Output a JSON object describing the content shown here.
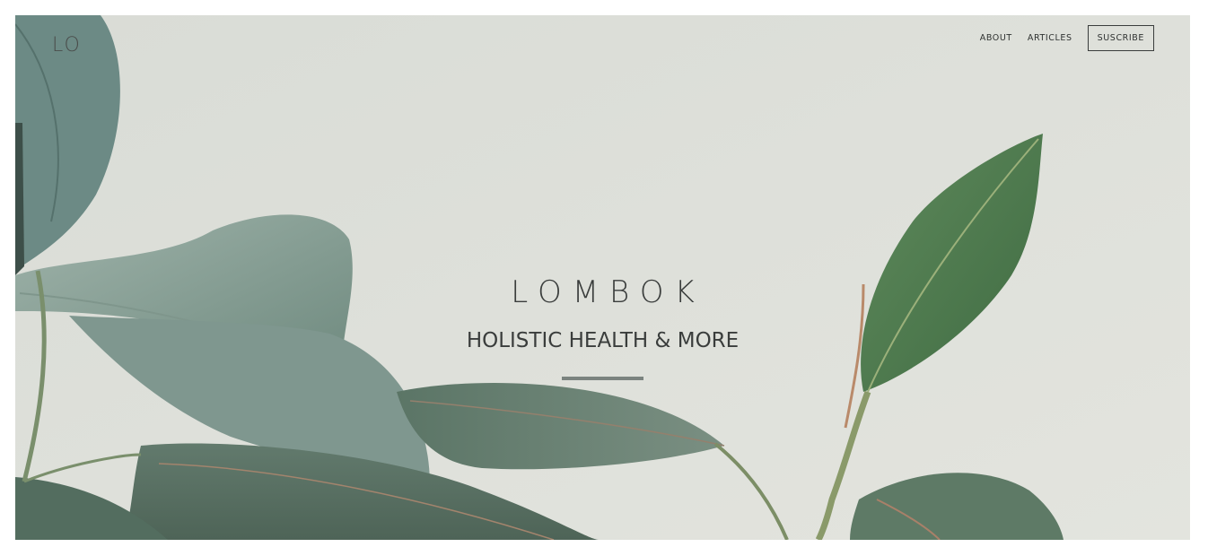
{
  "site": {
    "logo": "LO"
  },
  "nav": {
    "items": [
      "ABOUT",
      "ARTICLES"
    ],
    "subscribe_label": "SUSCRIBE"
  },
  "hero": {
    "title": "LOMBOK",
    "subtitle": "HOLISTIC HEALTH & MORE",
    "background": "plant-leaves-photo"
  },
  "colors": {
    "background": "#dfe1db",
    "text": "#3a3d3c",
    "divider": "#7b837f",
    "leaf_dark": "#4e6e52",
    "leaf_light": "#8fa69b"
  }
}
